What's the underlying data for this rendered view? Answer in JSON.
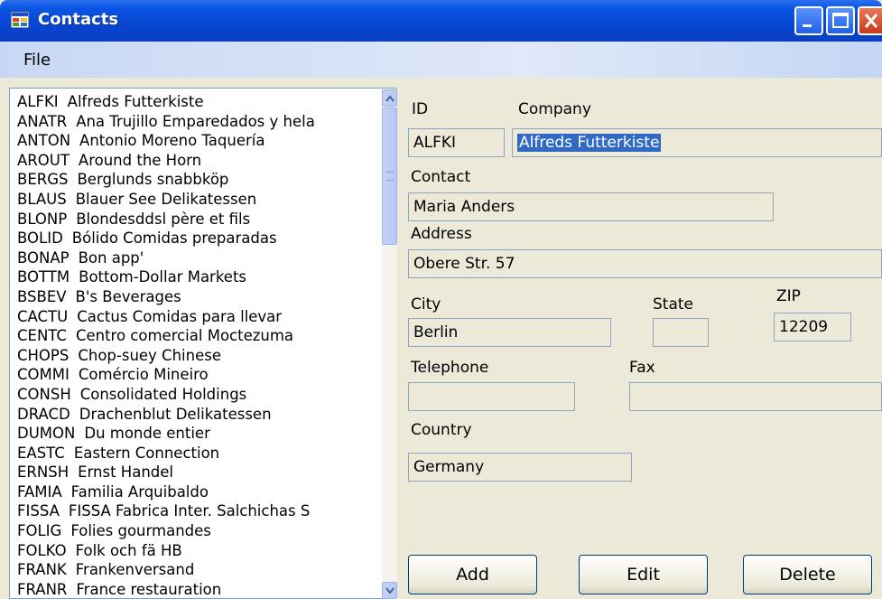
{
  "window": {
    "title": "Contacts"
  },
  "menu": {
    "file": "File"
  },
  "list": {
    "items": [
      {
        "code": "ALFKI",
        "name": "Alfreds Futterkiste"
      },
      {
        "code": "ANATR",
        "name": "Ana Trujillo Emparedados y hela"
      },
      {
        "code": "ANTON",
        "name": "Antonio Moreno Taquería"
      },
      {
        "code": "AROUT",
        "name": "Around the Horn"
      },
      {
        "code": "BERGS",
        "name": "Berglunds snabbköp"
      },
      {
        "code": "BLAUS",
        "name": "Blauer See Delikatessen"
      },
      {
        "code": "BLONP",
        "name": "Blondesddsl père et fils"
      },
      {
        "code": "BOLID",
        "name": "Bólido Comidas preparadas"
      },
      {
        "code": "BONAP",
        "name": "Bon app'"
      },
      {
        "code": "BOTTM",
        "name": "Bottom-Dollar Markets"
      },
      {
        "code": "BSBEV",
        "name": "B's Beverages"
      },
      {
        "code": "CACTU",
        "name": "Cactus Comidas para llevar"
      },
      {
        "code": "CENTC",
        "name": "Centro comercial Moctezuma"
      },
      {
        "code": "CHOPS",
        "name": "Chop-suey Chinese"
      },
      {
        "code": "COMMI",
        "name": "Comércio Mineiro"
      },
      {
        "code": "CONSH",
        "name": "Consolidated Holdings"
      },
      {
        "code": "DRACD",
        "name": "Drachenblut Delikatessen"
      },
      {
        "code": "DUMON",
        "name": "Du monde entier"
      },
      {
        "code": "EASTC",
        "name": "Eastern Connection"
      },
      {
        "code": "ERNSH",
        "name": "Ernst Handel"
      },
      {
        "code": "FAMIA",
        "name": "Familia Arquibaldo"
      },
      {
        "code": "FISSA",
        "name": "FISSA Fabrica Inter. Salchichas S"
      },
      {
        "code": "FOLIG",
        "name": "Folies gourmandes"
      },
      {
        "code": "FOLKO",
        "name": "Folk och fä HB"
      },
      {
        "code": "FRANK",
        "name": "Frankenversand"
      },
      {
        "code": "FRANR",
        "name": "France restauration"
      }
    ]
  },
  "form": {
    "id_label": "ID",
    "company_label": "Company",
    "id_value": "ALFKI",
    "company_value": "Alfreds Futterkiste",
    "contact_label": "Contact",
    "contact_value": "Maria Anders",
    "address_label": "Address",
    "address_value": "Obere Str. 57",
    "city_label": "City",
    "city_value": "Berlin",
    "state_label": "State",
    "state_value": "",
    "zip_label": "ZIP",
    "zip_value": "12209",
    "telephone_label": "Telephone",
    "telephone_value": "",
    "fax_label": "Fax",
    "fax_value": "",
    "country_label": "Country",
    "country_value": "Germany"
  },
  "buttons": {
    "add": "Add",
    "edit": "Edit",
    "delete": "Delete"
  },
  "colors": {
    "titlebar": "#0a55e4",
    "selection": "#316ac5",
    "background": "#ece9d8"
  }
}
